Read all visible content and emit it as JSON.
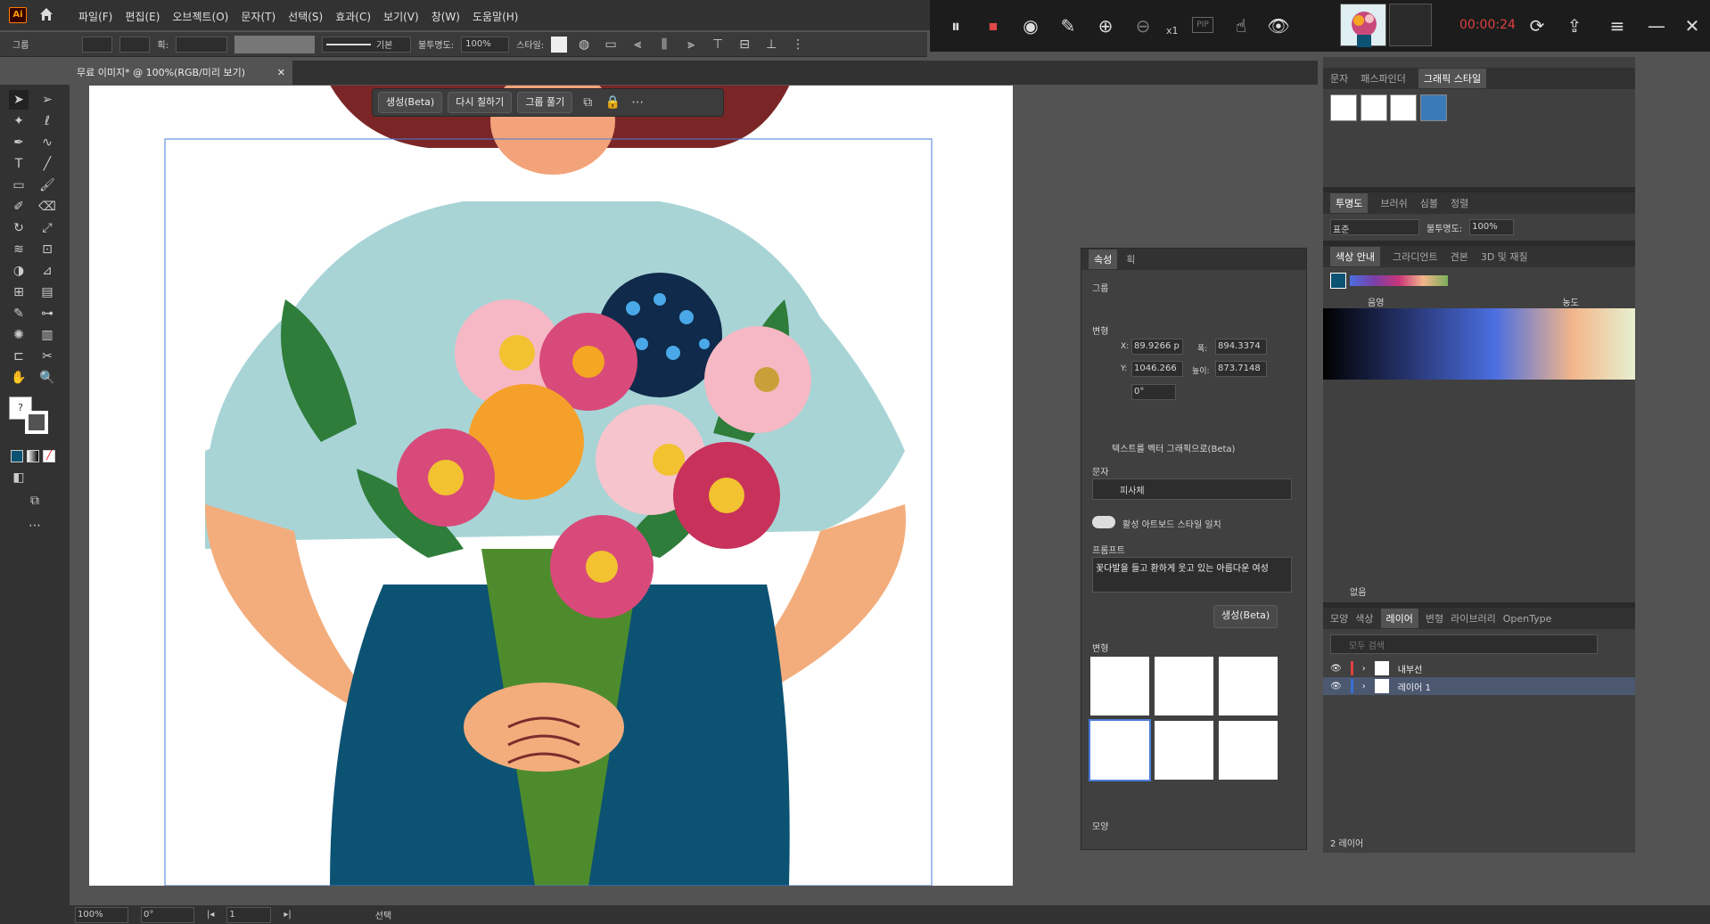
{
  "app": {
    "logo": "Ai",
    "menu": [
      "파일(F)",
      "편집(E)",
      "오브젝트(O)",
      "문자(T)",
      "선택(S)",
      "효과(C)",
      "보기(V)",
      "창(W)",
      "도움말(H)"
    ]
  },
  "control": {
    "group_label": "그룹",
    "stroke_label": "획:",
    "brush": "기본",
    "opacity_label": "불투명도:",
    "opacity": "100%",
    "style_label": "스타일:"
  },
  "recorder": {
    "time": "00:00:24",
    "zoom": "x1",
    "pip": "PIP"
  },
  "document": {
    "tab": "무료 이미지* @ 100%(RGB/미리 보기)"
  },
  "context": {
    "generate": "생성(Beta)",
    "recolor": "다시 칠하기",
    "ungroup": "그룹 풀기"
  },
  "status": {
    "zoom": "100%",
    "rotate": "0°",
    "artboard": "1",
    "tool": "선택"
  },
  "properties": {
    "tabs": [
      "속성",
      "획"
    ],
    "section": "그룹",
    "transform": "변형",
    "x_label": "X:",
    "x": "89.9266 p",
    "y_label": "Y:",
    "y": "1046.266",
    "w_label": "폭:",
    "w": "894.3374",
    "h_label": "높이:",
    "h": "873.7148",
    "angle": "0°",
    "t2v": "텍스트를 벡터 그래픽으로(Beta)",
    "type_label": "문자",
    "type": "피사체",
    "match_style": "활성 아트보드 스타일 일치",
    "prompt_label": "프롬프트",
    "prompt": "꽃다발을 들고 환하게 웃고 있는 아름다운 여성",
    "generate": "생성(Beta)",
    "variations": "변형",
    "appearance": "모양"
  },
  "graphic_styles": {
    "tabs": [
      "문자",
      "패스파인더",
      "그래픽 스타일"
    ]
  },
  "transparency": {
    "tabs": [
      "투명도",
      "브러쉬",
      "심볼",
      "정렬"
    ],
    "mode": "표준",
    "opacity_label": "불투명도:",
    "opacity": "100%"
  },
  "color_guide": {
    "tabs": [
      "색상 안내",
      "그라디언트",
      "견본",
      "3D 및 재질"
    ],
    "shade": "음영",
    "sat": "농도",
    "none": "없음",
    "harmony": [
      "#1d6fb8",
      "#4b6ee0",
      "#7b3fa8",
      "#c8357a",
      "#f3b68a",
      "#7cae5a"
    ]
  },
  "layers": {
    "tabs": [
      "모양",
      "색상",
      "레이어",
      "변형",
      "라이브러리",
      "OpenType"
    ],
    "search": "모두 검색",
    "items": [
      {
        "name": "내부선",
        "color": "#e04040"
      },
      {
        "name": "레이어 1",
        "color": "#3a6fd8"
      }
    ],
    "count": "2 레이어"
  }
}
